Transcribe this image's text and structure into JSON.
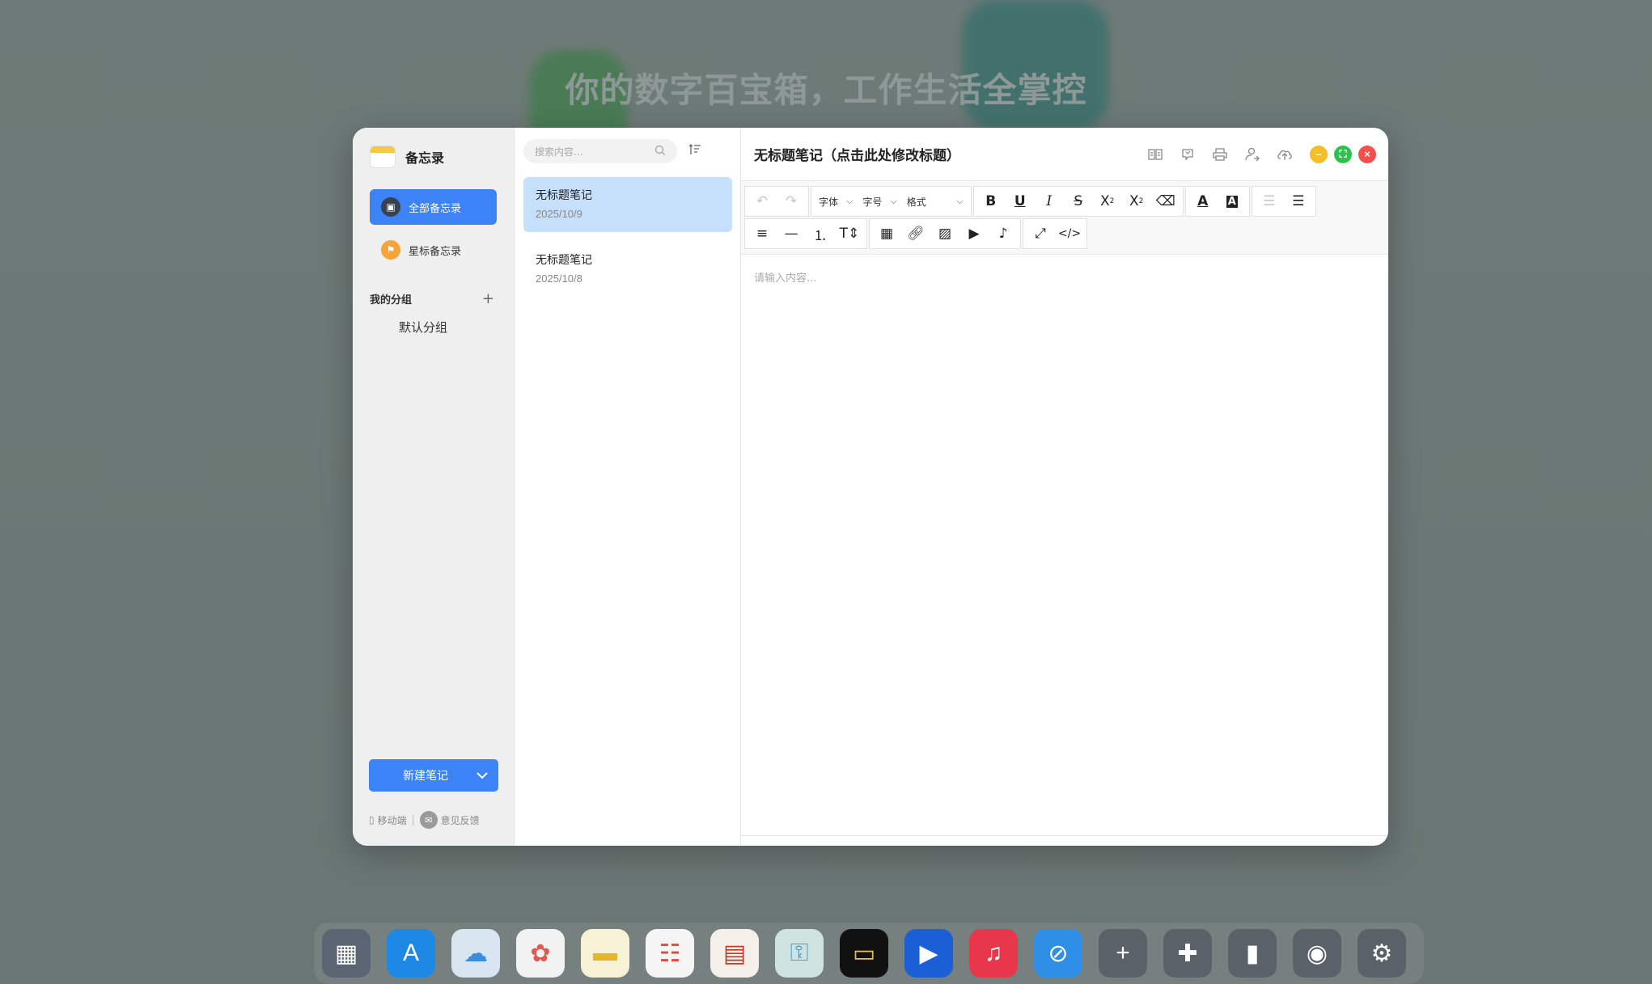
{
  "background": {
    "headline": "你的数字百宝箱，工作生活全掌控"
  },
  "sidebar": {
    "app_title": "备忘录",
    "nav": [
      {
        "label": "全部备忘录",
        "active": true
      },
      {
        "label": "星标备忘录",
        "active": false
      }
    ],
    "groups_title": "我的分组",
    "group_add": "+",
    "groups": [
      "默认分组"
    ],
    "new_note_label": "新建笔记",
    "footer": {
      "mobile_label": "移动端",
      "separator": "|",
      "feedback_label": "意见反馈"
    }
  },
  "list": {
    "search_placeholder": "搜索内容...",
    "notes": [
      {
        "title": "无标题笔记",
        "date": "2025/10/9",
        "active": true
      },
      {
        "title": "无标题笔记",
        "date": "2025/10/8",
        "active": false
      }
    ]
  },
  "editor": {
    "title": "无标题笔记（点击此处修改标题）",
    "font_select": "字体",
    "size_select": "字号",
    "format_select": "格式",
    "placeholder": "请输入内容..."
  },
  "colors": {
    "accent": "#3b83f6",
    "active_note": "#c6e0fb",
    "window_min": "#f5bd2a",
    "window_max": "#2dc250",
    "window_close": "#f4504b"
  },
  "dock": {
    "apps": [
      "launchpad-icon",
      "app-store-icon",
      "icloud-icon",
      "photos-icon",
      "notes-icon",
      "reminders-icon",
      "calendar-icon",
      "keychain-icon",
      "wallet-icon",
      "video-player-icon",
      "music-icon",
      "safari-icon",
      "calculator-icon",
      "plugins-icon",
      "brush-icon",
      "disk-utility-icon",
      "system-settings-icon"
    ]
  }
}
